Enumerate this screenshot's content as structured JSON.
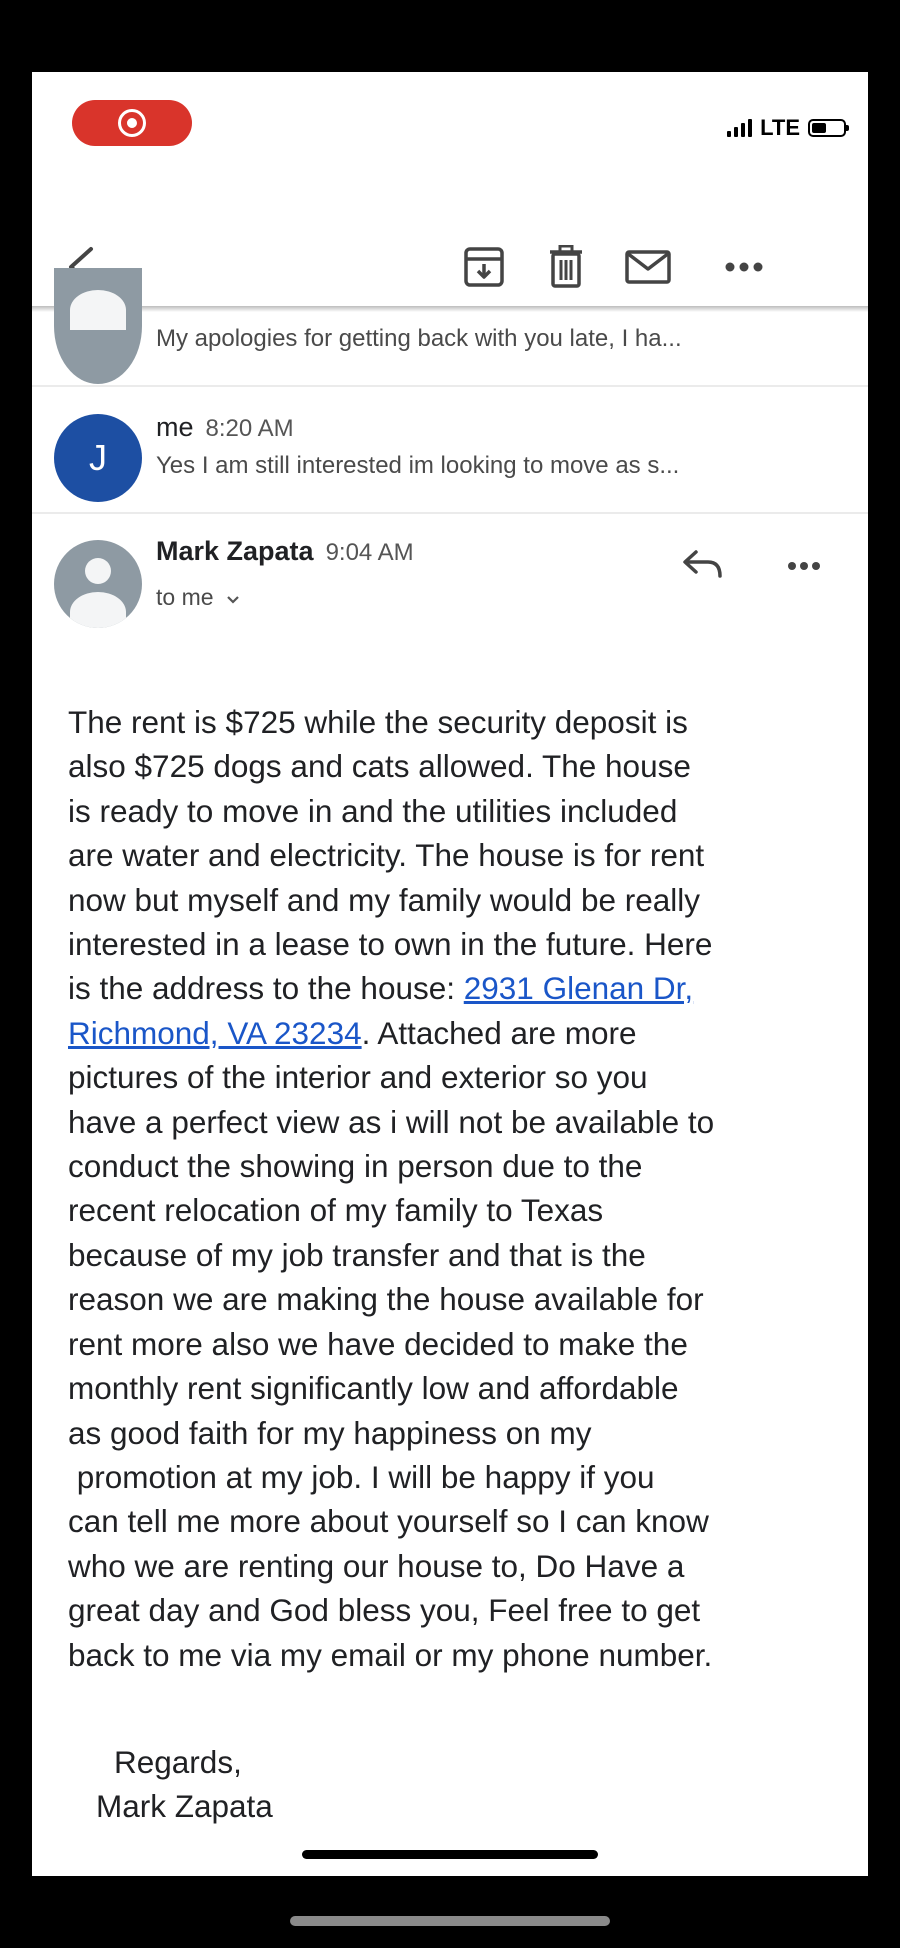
{
  "status_bar": {
    "carrier": "LTE"
  },
  "toolbar": {
    "icons": [
      "back-icon",
      "archive-icon",
      "trash-icon",
      "mail-icon",
      "more-icon"
    ]
  },
  "thread": {
    "collapsed": [
      {
        "snippet": "My apologies for getting back with you late, I ha..."
      },
      {
        "avatar_letter": "J",
        "sender": "me",
        "time": "8:20 AM",
        "snippet": "Yes I am still interested im looking to move as s..."
      }
    ],
    "open_message": {
      "sender": "Mark Zapata",
      "time": "9:04 AM",
      "recipient": "to me",
      "body_part1": "The rent is $725 while the security deposit is\nalso $725 dogs and cats allowed. The house\nis ready to move in and the utilities included\nare water and electricity. The house is for rent\nnow but myself and my family would be really\ninterested in a lease to own in the future. Here\nis the address to the house: ",
      "address_line1": "2931 Glenan Dr,",
      "address_line2": "Richmond, VA 23234",
      "body_part2": ". Attached are more\npictures of the interior and exterior so you\nhave a perfect view as i will not be available to\nconduct the showing in person due to the\nrecent relocation of my family to Texas\nbecause of my job transfer and that is the\nreason we are making the house available for\nrent more also we have decided to make the\nmonthly rent significantly low and affordable\nas good faith for my happiness on my\n promotion at my job. I will be happy if you\ncan tell me more about yourself so I can know\nwho we are renting our house to, Do Have a\ngreat day and God bless you, Feel free to get\nback to me via my email or my phone number.",
      "signoff": "Regards,",
      "signature": "Mark Zapata"
    }
  },
  "colors": {
    "record": "#d9342b",
    "avatar_j": "#1d4fa3",
    "avatar_grey": "#8e9aa3",
    "link": "#1a56c8"
  }
}
